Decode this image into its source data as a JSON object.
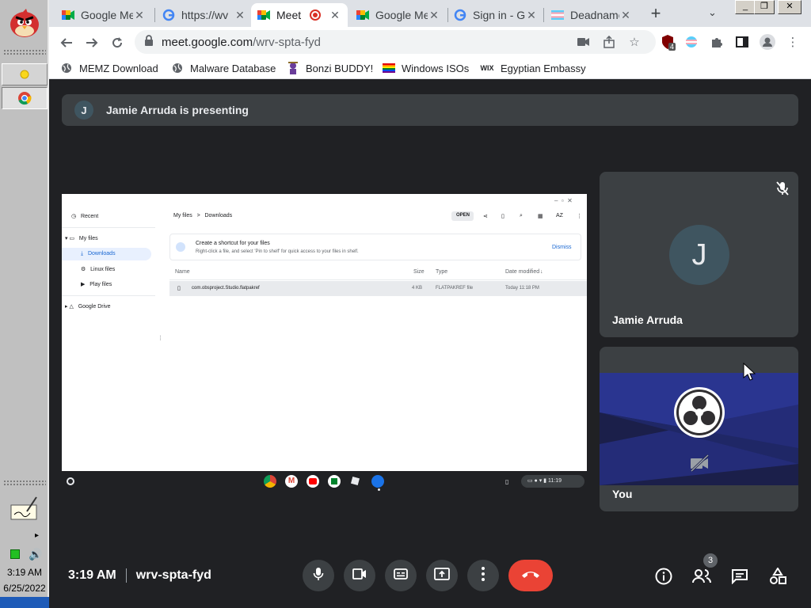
{
  "taskbar": {
    "clock_time": "3:19 AM",
    "clock_date": "6/25/2022"
  },
  "tabs": [
    {
      "title": "Google Me",
      "icon": "google-meet-icon"
    },
    {
      "title": "https://wv",
      "icon": "google-g-icon"
    },
    {
      "title": "Meet",
      "icon": "google-meet-icon",
      "active": true
    },
    {
      "title": "Google Me",
      "icon": "google-meet-icon"
    },
    {
      "title": "Sign in - G",
      "icon": "google-g-icon"
    },
    {
      "title": "Deadname",
      "icon": "trans-flag-icon"
    }
  ],
  "omnibox": {
    "host": "meet.google.com",
    "path": "/wrv-spta-fyd"
  },
  "extension_badge": "4",
  "bookmarks": [
    {
      "label": "MEMZ Download",
      "icon": "globe-icon"
    },
    {
      "label": "Malware Database",
      "icon": "globe-icon"
    },
    {
      "label": "Bonzi BUDDY!",
      "icon": "bonzi-icon"
    },
    {
      "label": "Windows ISOs",
      "icon": "rainbow-flag-icon"
    },
    {
      "label": "Egyptian Embassy",
      "icon": "wix-icon"
    }
  ],
  "meet": {
    "presenter_initial": "J",
    "presenting_text": "Jamie Arruda is presenting",
    "participants": [
      {
        "name": "Jamie Arruda",
        "initial": "J",
        "muted": true
      },
      {
        "name": "You",
        "camera_off": true
      }
    ],
    "time": "3:19 AM",
    "meeting_code": "wrv-spta-fyd",
    "people_count": "3"
  },
  "shared_screen": {
    "sidebar": {
      "recent": "Recent",
      "my_files": "My files",
      "downloads": "Downloads",
      "linux_files": "Linux files",
      "play_files": "Play files",
      "google_drive": "Google Drive"
    },
    "breadcrumb_root": "My files",
    "breadcrumb_current": "Downloads",
    "open_button": "OPEN",
    "sort_label": "AZ",
    "banner_title": "Create a shortcut for your files",
    "banner_text": "Right-click a file, and select 'Pin to shelf' for quick access to your files in shelf.",
    "banner_dismiss": "Dismiss",
    "columns": {
      "name": "Name",
      "size": "Size",
      "type": "Type",
      "date": "Date modified"
    },
    "file": {
      "name": "com.obsproject.Studio.flatpakref",
      "size": "4 KB",
      "type": "FLATPAKREF file",
      "date": "Today 11:18 PM"
    },
    "shelf_time": "11:19"
  },
  "colors": {
    "meet_bg": "#202124",
    "tile_bg": "#3c4043",
    "end_call": "#ea4335",
    "avatar_bg": "#3f5560"
  }
}
